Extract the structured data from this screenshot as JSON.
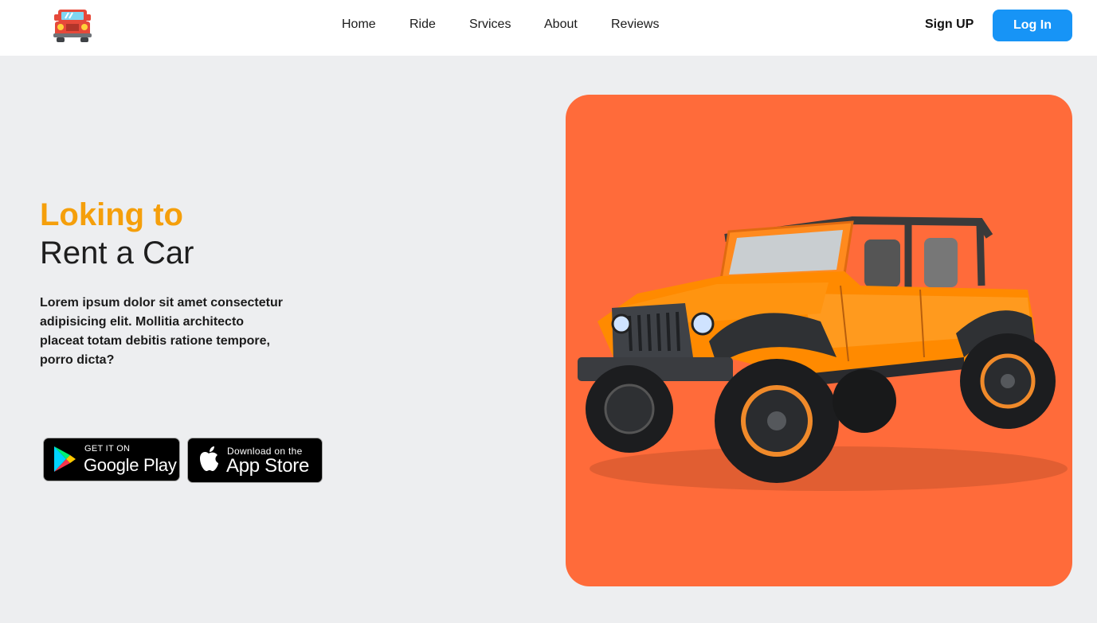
{
  "nav": {
    "logo_icon": "red-jeep-logo-icon",
    "links": [
      "Home",
      "Ride",
      "Srvices",
      "About",
      "Reviews"
    ],
    "signup_label": "Sign UP",
    "login_label": "Log In"
  },
  "hero": {
    "title_accent": "Loking to",
    "title_main": "Rent a Car",
    "description": "Lorem ipsum dolor sit amet consectetur adipisicing elit. Mollitia architecto placeat totam debitis ratione tempore, porro dicta?",
    "google_play": {
      "small": "GET IT ON",
      "big": "Google Play"
    },
    "app_store": {
      "small": "Download on the",
      "big": "App Store"
    },
    "image_icon": "orange-jeep-image"
  },
  "colors": {
    "accent": "#f59f0b",
    "login_button": "#1794f6",
    "card_background": "#ff6b3a",
    "page_background": "#edeef0"
  }
}
